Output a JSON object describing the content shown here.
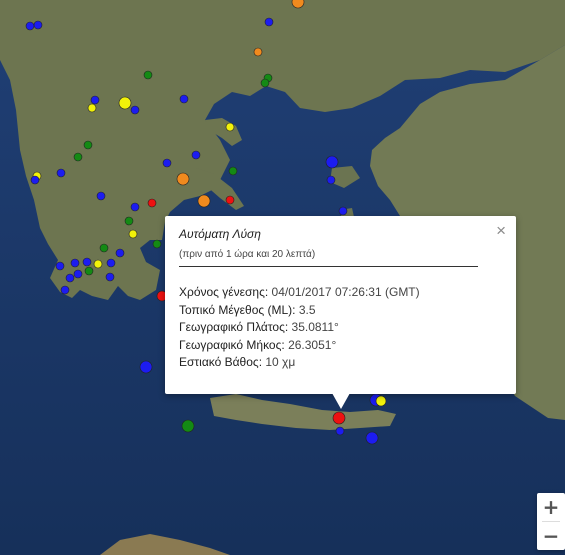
{
  "popup": {
    "title": "Αυτόματη Λύση",
    "subtitle": "(πριν από 1 ώρα και 20 λεπτά)",
    "close_symbol": "×",
    "details": [
      {
        "label": "Χρόνος γένεσης:",
        "value": "04/01/2017  07:26:31 (GMT)"
      },
      {
        "label": "Τοπικό Μέγεθος (ML):",
        "value": "3.5"
      },
      {
        "label": "Γεωγραφικό Πλάτος:",
        "value": "35.0811°"
      },
      {
        "label": "Γεωγραφικό Μήκος:",
        "value": "26.3051°"
      },
      {
        "label": "Εστιακό Βάθος:",
        "value": "10 χμ"
      }
    ]
  },
  "zoom": {
    "in_label": "+",
    "out_label": "−"
  },
  "marker_colors": {
    "blue": "#1c1cf0",
    "green": "#148a14",
    "yellow": "#f2f20a",
    "orange": "#f08a1e",
    "red": "#ee1111"
  }
}
